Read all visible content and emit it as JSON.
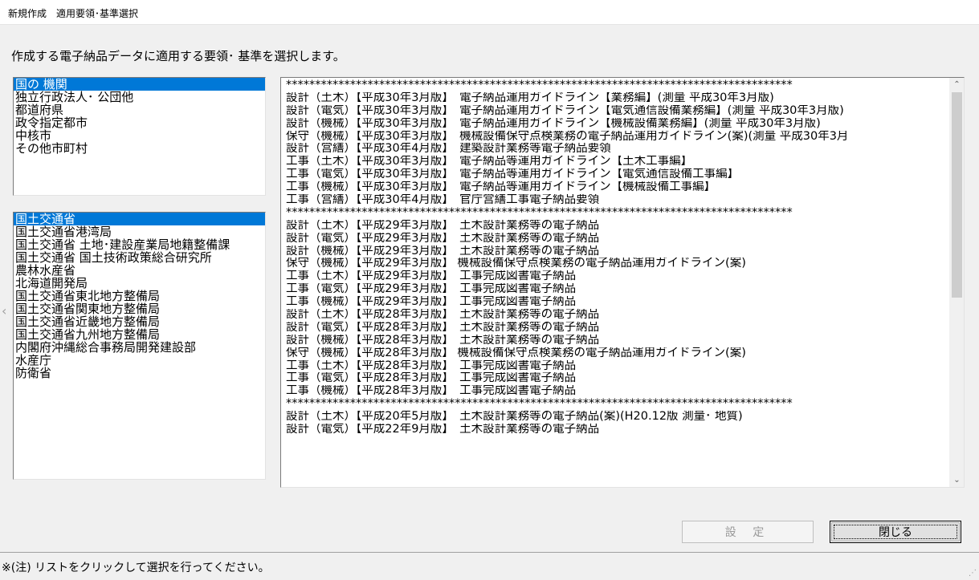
{
  "window": {
    "title": "新規作成　適用要領･基準選択"
  },
  "instruction": "作成する電子納品データに適用する要領･ 基準を選択します。",
  "org_types": {
    "selected_index": 0,
    "items": [
      "国の 機関",
      "独立行政法人･ 公団他",
      "都道府県",
      "政令指定都市",
      "中核市",
      "その他市町村"
    ]
  },
  "agencies": {
    "selected_index": 0,
    "items": [
      "国土交通省",
      "国土交通省港湾局",
      "国土交通省 土地･建設産業局地籍整備課",
      "国土交通省 国土技術政策総合研究所",
      "農林水産省",
      "北海道開発局",
      "国土交通省東北地方整備局",
      "国土交通省関東地方整備局",
      "国土交通省近畿地方整備局",
      "国土交通省九州地方整備局",
      "内閣府沖縄総合事務局開発建設部",
      "水産庁",
      "防衛省"
    ]
  },
  "standards": {
    "items": [
      "***************************************************************************************",
      "設計（土木）【平成30年3月版】　電子納品運用ガイドライン【業務編】(測量 平成30年3月版)",
      "設計（電気）【平成30年3月版】　電子納品運用ガイドライン【電気通信設備業務編】(測量 平成30年3月版)",
      "設計（機械）【平成30年3月版】　電子納品運用ガイドライン【機械設備業務編】(測量 平成30年3月版)",
      "保守（機械）【平成30年3月版】　機械設備保守点検業務の電子納品運用ガイドライン(案)(測量 平成30年3月",
      "設計（営繕）【平成30年4月版】　建築設計業務等電子納品要領",
      "工事（土木）【平成30年3月版】　電子納品等運用ガイドライン【土木工事編】",
      "工事（電気）【平成30年3月版】　電子納品等運用ガイドライン【電気通信設備工事編】",
      "工事（機械）【平成30年3月版】　電子納品等運用ガイドライン【機械設備工事編】",
      "工事（営繕）【平成30年4月版】　官庁営繕工事電子納品要領",
      "***************************************************************************************",
      "設計（土木）【平成29年3月版】　土木設計業務等の電子納品",
      "設計（電気）【平成29年3月版】　土木設計業務等の電子納品",
      "設計（機械）【平成29年3月版】　土木設計業務等の電子納品",
      "保守（機械）【平成29年3月版】 機械設備保守点検業務の電子納品運用ガイドライン(案)",
      "工事（土木）【平成29年3月版】　工事完成図書電子納品",
      "工事（電気）【平成29年3月版】　工事完成図書電子納品",
      "工事（機械）【平成29年3月版】　工事完成図書電子納品",
      "設計（土木）【平成28年3月版】　土木設計業務等の電子納品",
      "設計（電気）【平成28年3月版】　土木設計業務等の電子納品",
      "設計（機械）【平成28年3月版】　土木設計業務等の電子納品",
      "保守（機械）【平成28年3月版】 機械設備保守点検業務の電子納品運用ガイドライン(案)",
      "工事（土木）【平成28年3月版】　工事完成図書電子納品",
      "工事（電気）【平成28年3月版】　工事完成図書電子納品",
      "工事（機械）【平成28年3月版】　工事完成図書電子納品",
      "***************************************************************************************",
      "設計（土木）【平成20年5月版】　土木設計業務等の電子納品(案)(H20.12版 測量･ 地質)",
      "設計（電気）【平成22年9月版】　土木設計業務等の電子納品"
    ]
  },
  "buttons": {
    "set_label": "設 定",
    "close_label": "閉じる"
  },
  "status": {
    "text": "※(注) リストをクリックして選択を行ってください。"
  },
  "colors": {
    "selection": "#0078d7",
    "background": "#f0f0f0"
  }
}
